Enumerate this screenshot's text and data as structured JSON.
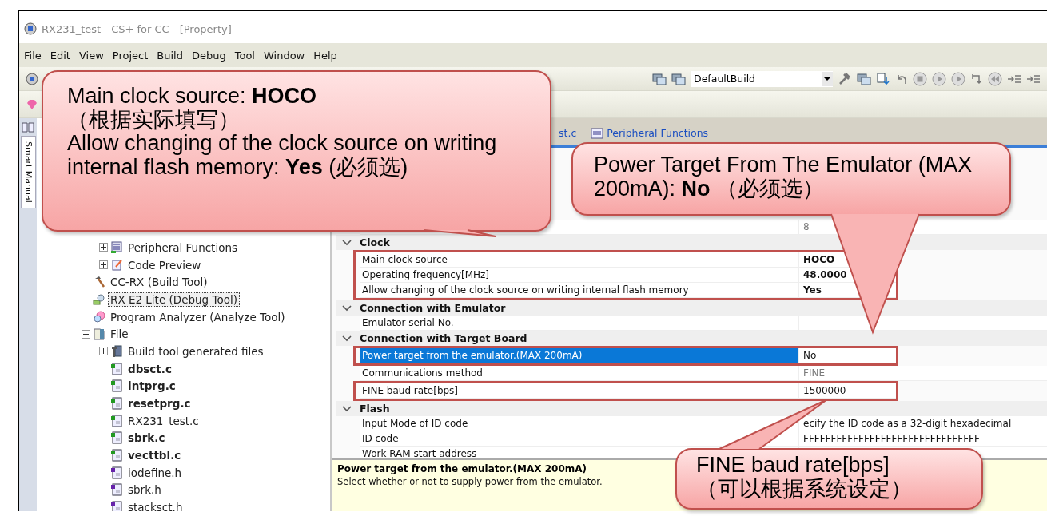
{
  "window": {
    "title": "RX231_test - CS+ for CC - [Property]"
  },
  "menu": [
    "File",
    "Edit",
    "View",
    "Project",
    "Build",
    "Debug",
    "Tool",
    "Window",
    "Help"
  ],
  "toolbar": {
    "build_mode": "DefaultBuild"
  },
  "side_tab": {
    "label": "Smart Manual"
  },
  "tree": [
    {
      "children": [
        {
          "label": "Peripheral Functions",
          "kind": "peripheral",
          "expanded": false,
          "bold": false,
          "selected": false
        },
        {
          "label": "Code Preview",
          "kind": "preview",
          "expanded": false,
          "bold": false,
          "selected": false
        }
      ]
    },
    {
      "label": "CC-RX (Build Tool)",
      "kind": "hammer",
      "bold": false,
      "selected": false
    },
    {
      "label": "RX E2 Lite (Debug Tool)",
      "kind": "debug",
      "bold": false,
      "selected": true
    },
    {
      "label": "Program Analyzer (Analyze Tool)",
      "kind": "analyzer",
      "bold": false,
      "selected": false
    },
    {
      "label": "File",
      "kind": "folder",
      "expanded": true,
      "bold": false,
      "selected": false,
      "children": [
        {
          "label": "Build tool generated files",
          "kind": "files",
          "expanded": false,
          "bold": false,
          "selected": false
        },
        {
          "label": "dbsct.c",
          "kind": "c-file",
          "bold": true,
          "selected": false
        },
        {
          "label": "intprg.c",
          "kind": "c-file",
          "bold": true,
          "selected": false
        },
        {
          "label": "resetprg.c",
          "kind": "c-file",
          "bold": true,
          "selected": false
        },
        {
          "label": "RX231_test.c",
          "kind": "c-file",
          "bold": false,
          "selected": false
        },
        {
          "label": "sbrk.c",
          "kind": "c-file",
          "bold": true,
          "selected": false
        },
        {
          "label": "vecttbl.c",
          "kind": "c-file",
          "bold": true,
          "selected": false
        },
        {
          "label": "iodefine.h",
          "kind": "h-file",
          "bold": false,
          "selected": false
        },
        {
          "label": "sbrk.h",
          "kind": "h-file",
          "bold": false,
          "selected": false
        },
        {
          "label": "stacksct.h",
          "kind": "h-file",
          "bold": false,
          "selected": false
        }
      ]
    }
  ],
  "editor_tabs": [
    {
      "label": "st.c",
      "selected": false
    },
    {
      "label": "Peripheral Functions",
      "selected": false
    }
  ],
  "properties": [
    {
      "kind": "row",
      "value": "8",
      "bold": false,
      "disabled": true,
      "outlined": false
    },
    {
      "kind": "section",
      "label": "Clock",
      "expanded": true
    },
    {
      "kind": "row",
      "label": "Main clock source",
      "value": "HOCO",
      "bold": true,
      "disabled": false,
      "selected": false,
      "outlined": true
    },
    {
      "kind": "row",
      "label": "Operating frequency[MHz]",
      "value": "48.0000",
      "bold": true,
      "disabled": false,
      "selected": false,
      "outlined": true
    },
    {
      "kind": "row",
      "label": "Allow changing of the clock source on writing internal flash memory",
      "value": "Yes",
      "bold": true,
      "disabled": false,
      "selected": false,
      "outlined": true
    },
    {
      "kind": "section",
      "label": "Connection with Emulator",
      "expanded": true
    },
    {
      "kind": "row",
      "label": "Emulator serial No.",
      "selected": false,
      "outlined": false
    },
    {
      "kind": "section",
      "label": "Connection with Target Board",
      "expanded": true
    },
    {
      "kind": "row",
      "label": "Power target from the emulator.(MAX 200mA)",
      "value": "No",
      "bold": false,
      "disabled": false,
      "selected": true,
      "outlined": true
    },
    {
      "kind": "row",
      "label": "Communications method",
      "value": "FINE",
      "bold": false,
      "disabled": true,
      "selected": false,
      "outlined": false
    },
    {
      "kind": "row",
      "label": "FINE baud rate[bps]",
      "value": "1500000",
      "bold": false,
      "disabled": false,
      "selected": false,
      "outlined": true
    },
    {
      "kind": "section",
      "label": "Flash",
      "expanded": true
    },
    {
      "kind": "row",
      "label": "Input Mode of ID code",
      "value": "ecify the ID code as a 32-digit hexadecimal",
      "bold": false,
      "disabled": false,
      "selected": false,
      "outlined": false
    },
    {
      "kind": "row",
      "label": "ID code",
      "value": "FFFFFFFFFFFFFFFFFFFFFFFFFFFFFFFF",
      "bold": false,
      "disabled": false,
      "selected": false,
      "outlined": false
    },
    {
      "kind": "row",
      "label": "Work RAM start address",
      "selected": false,
      "outlined": false
    }
  ],
  "description": {
    "title": "Power target from the emulator.(MAX 200mA)",
    "text": "Select whether or not to supply power from the emulator."
  },
  "callouts": [
    {
      "lines": [
        "Main clock source: **HOCO**",
        "（根据实际填写）",
        "Allow changing of the clock source on writing internal flash memory: **Yes** (必须选)"
      ]
    },
    {
      "lines": [
        "Power Target From The Emulator (MAX 200mA): **No** （必须选）"
      ]
    },
    {
      "lines": [
        "FINE baud rate[bps]",
        "（可以根据系统设定）"
      ]
    }
  ]
}
